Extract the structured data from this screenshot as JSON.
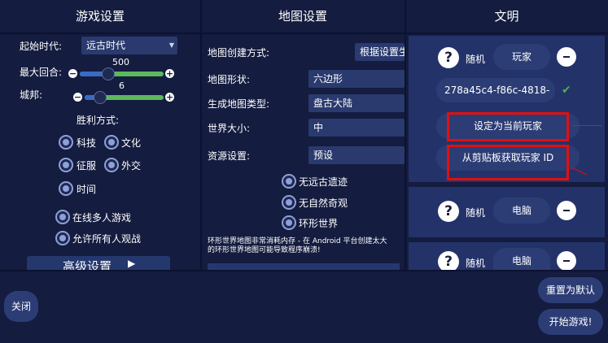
{
  "headers": {
    "game": "游戏设置",
    "map": "地图设置",
    "civs": "文明"
  },
  "game": {
    "start_era_label": "起始时代:",
    "start_era_value": "远古时代",
    "max_turns_label": "最大回合:",
    "max_turns_value": "500",
    "city_states_label": "城邦:",
    "city_states_value": "6",
    "victory_label": "胜利方式:",
    "victories": [
      "科技",
      "文化",
      "征服",
      "外交",
      "时间"
    ],
    "online_mp": "在线多人游戏",
    "spectators": "允许所有人观战",
    "advanced_btn": "高级设置"
  },
  "map": {
    "creation_label": "地图创建方式:",
    "creation_value": "根据设置生成",
    "shape_label": "地图形状:",
    "shape_value": "六边形",
    "type_label": "生成地图类型:",
    "type_value": "盘古大陆",
    "size_label": "世界大小:",
    "size_value": "中",
    "resource_label": "资源设置:",
    "resource_value": "预设",
    "options": [
      "无远古遗迹",
      "无自然奇观",
      "环形世界"
    ],
    "warning": "环形世界地图非常消耗内存 - 在 Android 平台创建太大的环形世界地图可能导致程序崩溃!"
  },
  "civs": {
    "player1": {
      "nation": "随机",
      "type": "玩家",
      "id": "278a45c4-f86c-4818-"
    },
    "set_current_btn": "设定为当前玩家",
    "clipboard_btn": "从剪贴板获取玩家 ID",
    "player2": {
      "nation": "随机",
      "type": "电脑"
    },
    "player3": {
      "nation": "随机",
      "type": "电脑"
    }
  },
  "bottom": {
    "close": "关闭",
    "reset": "重置为默认",
    "start": "开始游戏!"
  },
  "colors": {
    "bg": "#141c3f",
    "highlight": "#e01010",
    "check": "#4caf50"
  }
}
